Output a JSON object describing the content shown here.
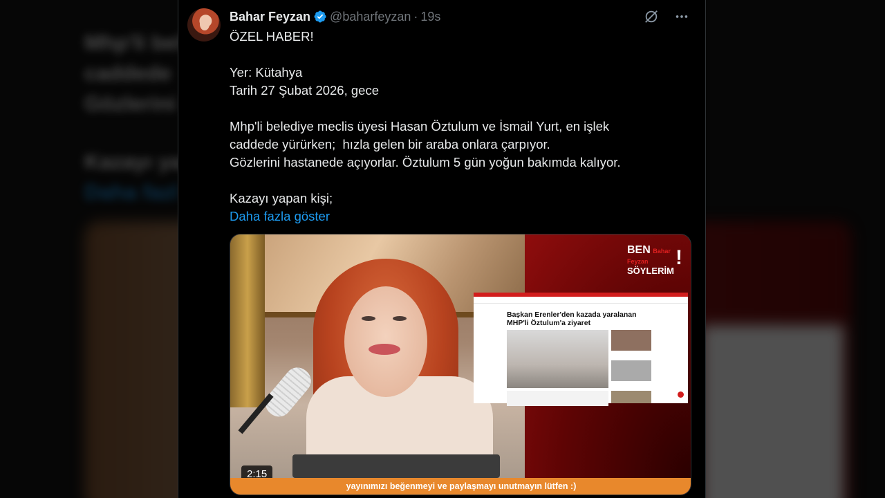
{
  "tweet": {
    "author_name": "Bahar Feyzan",
    "handle": "@baharfeyzan",
    "separator": "·",
    "time": "19s",
    "lines": [
      "ÖZEL HABER!",
      "",
      "Yer: Kütahya",
      "Tarih 27 Şubat 2026, gece",
      "",
      "Mhp'li belediye meclis üyesi Hasan Öztulum ve İsmail Yurt, en işlek",
      "caddede yürürken;  hızla gelen bir araba onlara çarpıyor.",
      "Gözlerini hastanede açıyorlar. Öztulum 5 gün yoğun bakımda kalıyor.",
      "",
      "Kazayı yapan kişi;"
    ],
    "show_more": "Daha fazla göster"
  },
  "media": {
    "duration": "2:15",
    "banner": "yayınımızı beğenmeyi ve paylaşmayı unutmayın lütfen :)",
    "logo": {
      "ben": "BEN",
      "bf": "Bahar Feyzan",
      "soylerim": "SÖYLERİM",
      "bang": "!"
    },
    "news_headline": "Başkan Erenler'den kazada yaralanan MHP'li Öztulum'a ziyaret"
  },
  "backdrop": {
    "lines": [
      "Mhp'li bel",
      "caddede",
      "Gözlerini",
      "Kazayı ya",
      "Daha fazl"
    ]
  },
  "colors": {
    "link": "#1d9bf0",
    "verified": "#1d9bf0",
    "muted": "#71767b",
    "banner": "#e8882c"
  },
  "icons": {
    "verified": "verified-badge-icon",
    "grok": "grok-icon",
    "more": "more-options-icon"
  }
}
